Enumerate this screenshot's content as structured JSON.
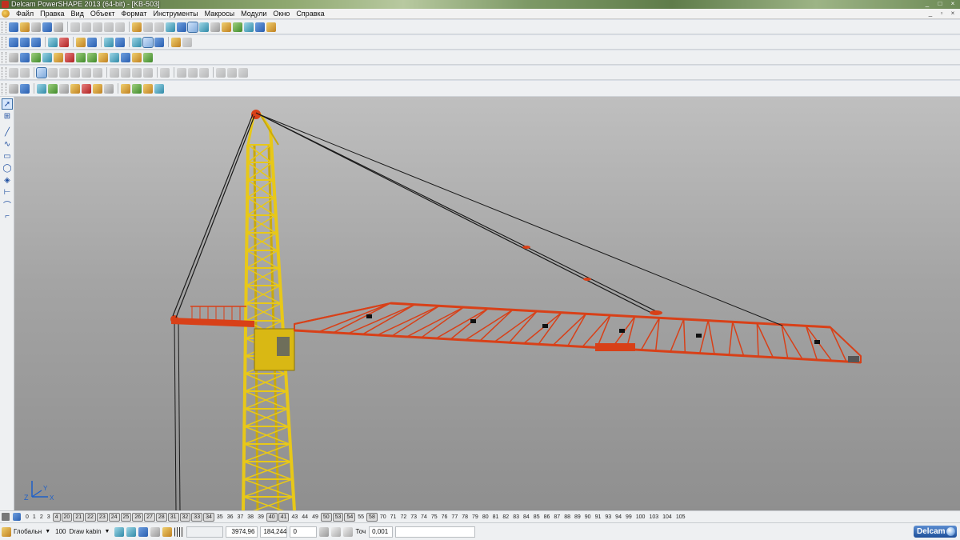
{
  "window": {
    "title": "Delcam PowerSHAPE 2013 (64-bit) - [KB-503]",
    "controls": [
      "_",
      "□",
      "×"
    ]
  },
  "menu": {
    "items": [
      "Файл",
      "Правка",
      "Вид",
      "Объект",
      "Формат",
      "Инструменты",
      "Макросы",
      "Модули",
      "Окно",
      "Справка"
    ],
    "mdi_controls": [
      "_",
      "▫",
      "×"
    ]
  },
  "levels": {
    "items": [
      "0",
      "1",
      "2",
      "3",
      "4",
      "20",
      "21",
      "22",
      "23",
      "24",
      "25",
      "26",
      "27",
      "28",
      "31",
      "32",
      "33",
      "34",
      "35",
      "36",
      "37",
      "38",
      "39",
      "40",
      "41",
      "43",
      "44",
      "49",
      "50",
      "53",
      "54",
      "55",
      "58",
      "70",
      "71",
      "72",
      "73",
      "74",
      "75",
      "76",
      "77",
      "78",
      "79",
      "80",
      "81",
      "82",
      "83",
      "84",
      "85",
      "86",
      "87",
      "88",
      "89",
      "90",
      "91",
      "93",
      "94",
      "99",
      "100",
      "103",
      "104",
      "105"
    ],
    "active": [
      "4",
      "20",
      "21",
      "22",
      "23",
      "24",
      "25",
      "26",
      "27",
      "28",
      "31",
      "32",
      "33",
      "34",
      "40",
      "41",
      "50",
      "53",
      "54",
      "58"
    ]
  },
  "statusbar": {
    "workplane": "Глобальн",
    "line_width": "100",
    "level_name": "Draw kabin",
    "x": "3974,96",
    "y": "184,244",
    "z": "0",
    "tolerance_label": "Точ",
    "tolerance": "0,001",
    "brand": "Delcam"
  },
  "viewport": {
    "axis_labels": [
      "Z",
      "X",
      "Y"
    ],
    "colors": {
      "tower": "#e8c818",
      "jib": "#d84018",
      "cable": "#1a1a1a"
    }
  }
}
